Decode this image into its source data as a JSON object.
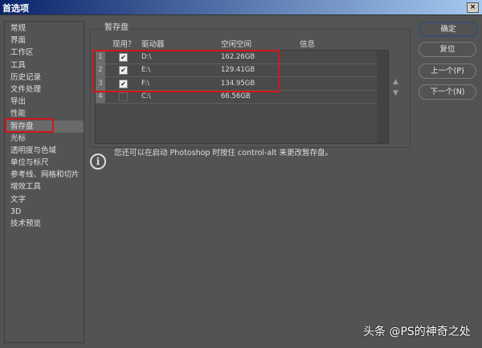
{
  "window": {
    "title": "首选项",
    "close": "×"
  },
  "sidebar": {
    "items": [
      "常规",
      "界面",
      "工作区",
      "工具",
      "历史记录",
      "文件处理",
      "导出",
      "性能",
      "暂存盘",
      "光标",
      "透明度与色域",
      "单位与标尺",
      "参考线、网格和切片",
      "增效工具",
      "文字",
      "3D",
      "技术预览"
    ],
    "selected": "暂存盘"
  },
  "scratch": {
    "group_label": "暂存盘",
    "headers": {
      "active": "现用？",
      "drive": "驱动器",
      "free": "空闲空间",
      "info": "信息"
    },
    "rows": [
      {
        "n": "1",
        "checked": true,
        "drive": "D:\\",
        "free": "162.26GB"
      },
      {
        "n": "2",
        "checked": true,
        "drive": "E:\\",
        "free": "129.41GB"
      },
      {
        "n": "3",
        "checked": true,
        "drive": "F:\\",
        "free": "134.95GB"
      },
      {
        "n": "4",
        "checked": false,
        "drive": "C:\\",
        "free": "66.56GB"
      }
    ],
    "up": "▲",
    "down": "▼",
    "note": "您还可以在启动 Photoshop 时按住 control-alt 来更改暂存盘。"
  },
  "buttons": {
    "ok": "确定",
    "reset": "复位",
    "prev": "上一个(P)",
    "next": "下一个(N)"
  },
  "watermark": "头条 @PS的神奇之处",
  "colors": {
    "highlight": "#d0171b"
  }
}
